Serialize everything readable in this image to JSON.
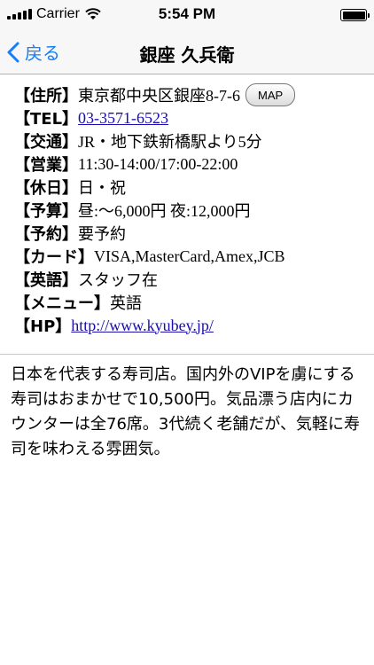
{
  "statusbar": {
    "carrier": "Carrier",
    "time": "5:54 PM"
  },
  "navbar": {
    "back_label": "戻る",
    "title": "銀座 久兵衛"
  },
  "info": {
    "address_label": "【住所】",
    "address": "東京都中央区銀座8-7-6",
    "map_button": "MAP",
    "tel_label": "【TEL】",
    "tel": "03-3571-6523",
    "access_label": "【交通】",
    "access": "JR・地下鉄新橋駅より5分",
    "hours_label": "【営業】",
    "hours": "11:30-14:00/17:00-22:00",
    "holiday_label": "【休日】",
    "holiday": "日・祝",
    "budget_label": "【予算】",
    "budget": "昼:〜6,000円 夜:12,000円",
    "reservation_label": "【予約】",
    "reservation": "要予約",
    "card_label": "【カード】",
    "card": "VISA,MasterCard,Amex,JCB",
    "english_label": "【英語】",
    "english": "スタッフ在",
    "menu_label": "【メニュー】",
    "menu": "英語",
    "hp_label": "【HP】",
    "hp": "http://www.kyubey.jp/"
  },
  "description": "日本を代表する寿司店。国内外のVIPを虜にする寿司はおまかせで10,500円。気品漂う店内にカウンターは全76席。3代続く老舗だが、気軽に寿司を味わえる雰囲気。"
}
